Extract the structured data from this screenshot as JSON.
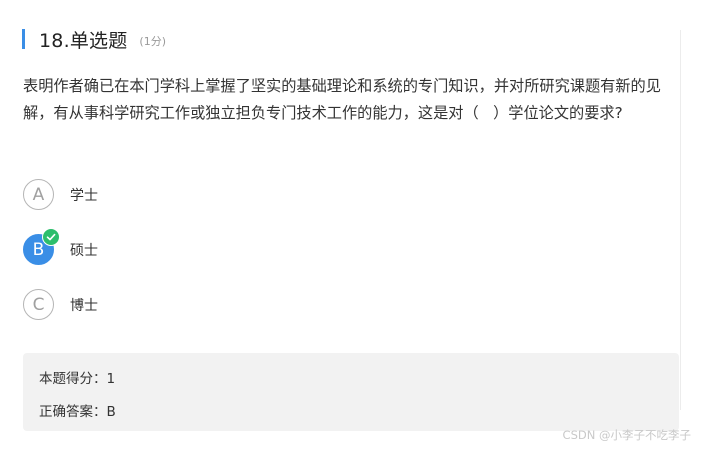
{
  "question": {
    "number_title": "18.单选题",
    "score_note": "(1分)",
    "stem": "表明作者确已在本门学科上掌握了坚实的基础理论和系统的专门知识，并对所研究课题有新的见解，有从事科学研究工作或独立担负专门技术工作的能力，这是对（   ）学位论文的要求?"
  },
  "options": [
    {
      "letter": "A",
      "text": "学士",
      "selected": false
    },
    {
      "letter": "B",
      "text": "硕士",
      "selected": true
    },
    {
      "letter": "C",
      "text": "博士",
      "selected": false
    }
  ],
  "result": {
    "score_line": "本题得分：1",
    "answer_line": "正确答案：B"
  },
  "watermark": "CSDN @小李子不吃李子",
  "colors": {
    "accent": "#3a8ee6",
    "correct": "#2dbe6c"
  },
  "icons": {
    "correct_badge": "check-icon"
  }
}
